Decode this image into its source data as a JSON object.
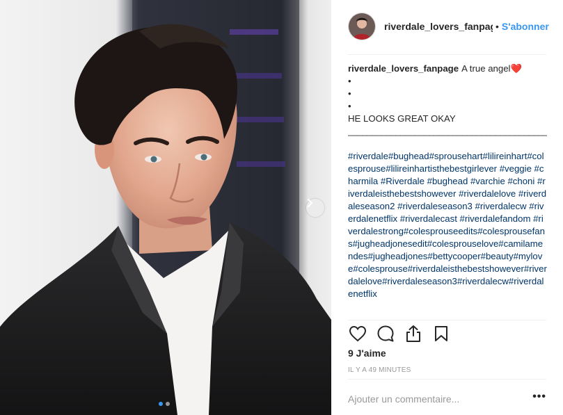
{
  "post": {
    "username": "riverdale_lovers_fanpage",
    "separator": "•",
    "follow_label": "S'abonner"
  },
  "caption": {
    "username": "riverdale_lovers_fanpage",
    "text": "A true angel",
    "heart": "❤️",
    "bullets": [
      "•",
      "•",
      "•"
    ],
    "shout": "HE LOOKS GREAT OKAY",
    "divider": "_____________________________________________",
    "hashtags": "#riverdale#bughead#sprousehart#lilireinhart#colesprouse#lilireinhartisthebestgirlever #veggie #charmila #Riverdale #bughead #varchie #choni #riverdaleisthebestshowever #riverdalelove #riverdaleseason2 #riverdaleseason3 #riverdalecw #riverdalenetflix #riverdalecast #riverdalefandom #riverdalestrong#colesprouseedits#colesprousefans#jugheadjonesedit#colesprouselove#camilamendes#jugheadjones#bettycooper#beauty#mylove#colesprouse#riverdaleisthebestshowever#riverdalelove#riverdaleseason3#riverdalecw#riverdalenetflix"
  },
  "likes": "9 J'aime",
  "timestamp": "IL Y A 49 MINUTES",
  "comment_placeholder": "Ajouter un commentaire...",
  "more_options": "•••",
  "carousel": {
    "slides": 2,
    "active": 1
  },
  "icons": {
    "like": "heart-icon",
    "comment": "comment-icon",
    "share": "share-icon",
    "save": "bookmark-icon",
    "next": "chevron-right-icon"
  },
  "colors": {
    "link": "#003569",
    "follow": "#3897f0",
    "muted": "#999999",
    "text": "#262626"
  }
}
